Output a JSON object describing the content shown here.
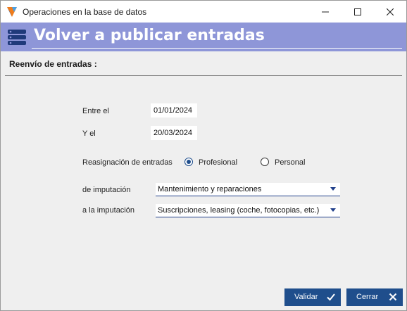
{
  "window": {
    "title": "Operaciones en la base de datos"
  },
  "header": {
    "title": "Volver a publicar entradas"
  },
  "section": {
    "title": "Reenvío de entradas :"
  },
  "form": {
    "from_label": "Entre el",
    "from_value": "01/01/2024",
    "to_label": "Y el",
    "to_value": "20/03/2024",
    "reassign_label": "Reasignación de entradas",
    "option_professional": "Profesional",
    "option_personal": "Personal",
    "selected_option": "Profesional",
    "from_imputation_label": "de imputación",
    "from_imputation_value": "Mantenimiento y reparaciones",
    "to_imputation_label": "a la imputación",
    "to_imputation_value": "Suscripciones, leasing (coche, fotocopias, etc.)"
  },
  "buttons": {
    "validate": "Validar",
    "close": "Cerrar"
  },
  "colors": {
    "accent": "#1f4e8c",
    "header_band": "#8e96d8"
  }
}
